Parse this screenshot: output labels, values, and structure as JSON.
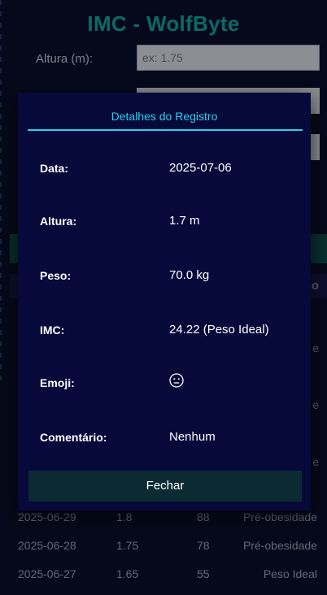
{
  "app": {
    "title": "IMC - WolfByte",
    "height_label": "Altura (m):",
    "height_placeholder": "ex: 1.75",
    "partial_header_char": "o",
    "partial_cells": [
      "e",
      "e",
      "e"
    ]
  },
  "history": {
    "rows": [
      {
        "date": "2025-06-29",
        "height": "1.8",
        "weight": "88",
        "classification": "Pré-obesidade"
      },
      {
        "date": "2025-06-28",
        "height": "1.75",
        "weight": "78",
        "classification": "Pré-obesidade"
      },
      {
        "date": "2025-06-27",
        "height": "1.65",
        "weight": "55",
        "classification": "Peso Ideal"
      }
    ]
  },
  "modal": {
    "title": "Detalhes do Registro",
    "fields": {
      "date": {
        "label": "Data:",
        "value": "2025-07-06"
      },
      "height": {
        "label": "Altura:",
        "value": "1.7 m"
      },
      "weight": {
        "label": "Peso:",
        "value": "70.0 kg"
      },
      "bmi": {
        "label": "IMC:",
        "value": "24.22 (Peso Ideal)"
      },
      "emoji": {
        "label": "Emoji:",
        "icon": "neutral-face-icon"
      },
      "comment": {
        "label": "Comentário:",
        "value": "Nenhum"
      }
    },
    "close_label": "Fechar"
  },
  "colors": {
    "accent": "#22d3ee",
    "title_teal": "#0fa3a0",
    "background": "#0a0e2a",
    "modal_bg": "#07093a",
    "button_bg": "#0b2a32"
  }
}
